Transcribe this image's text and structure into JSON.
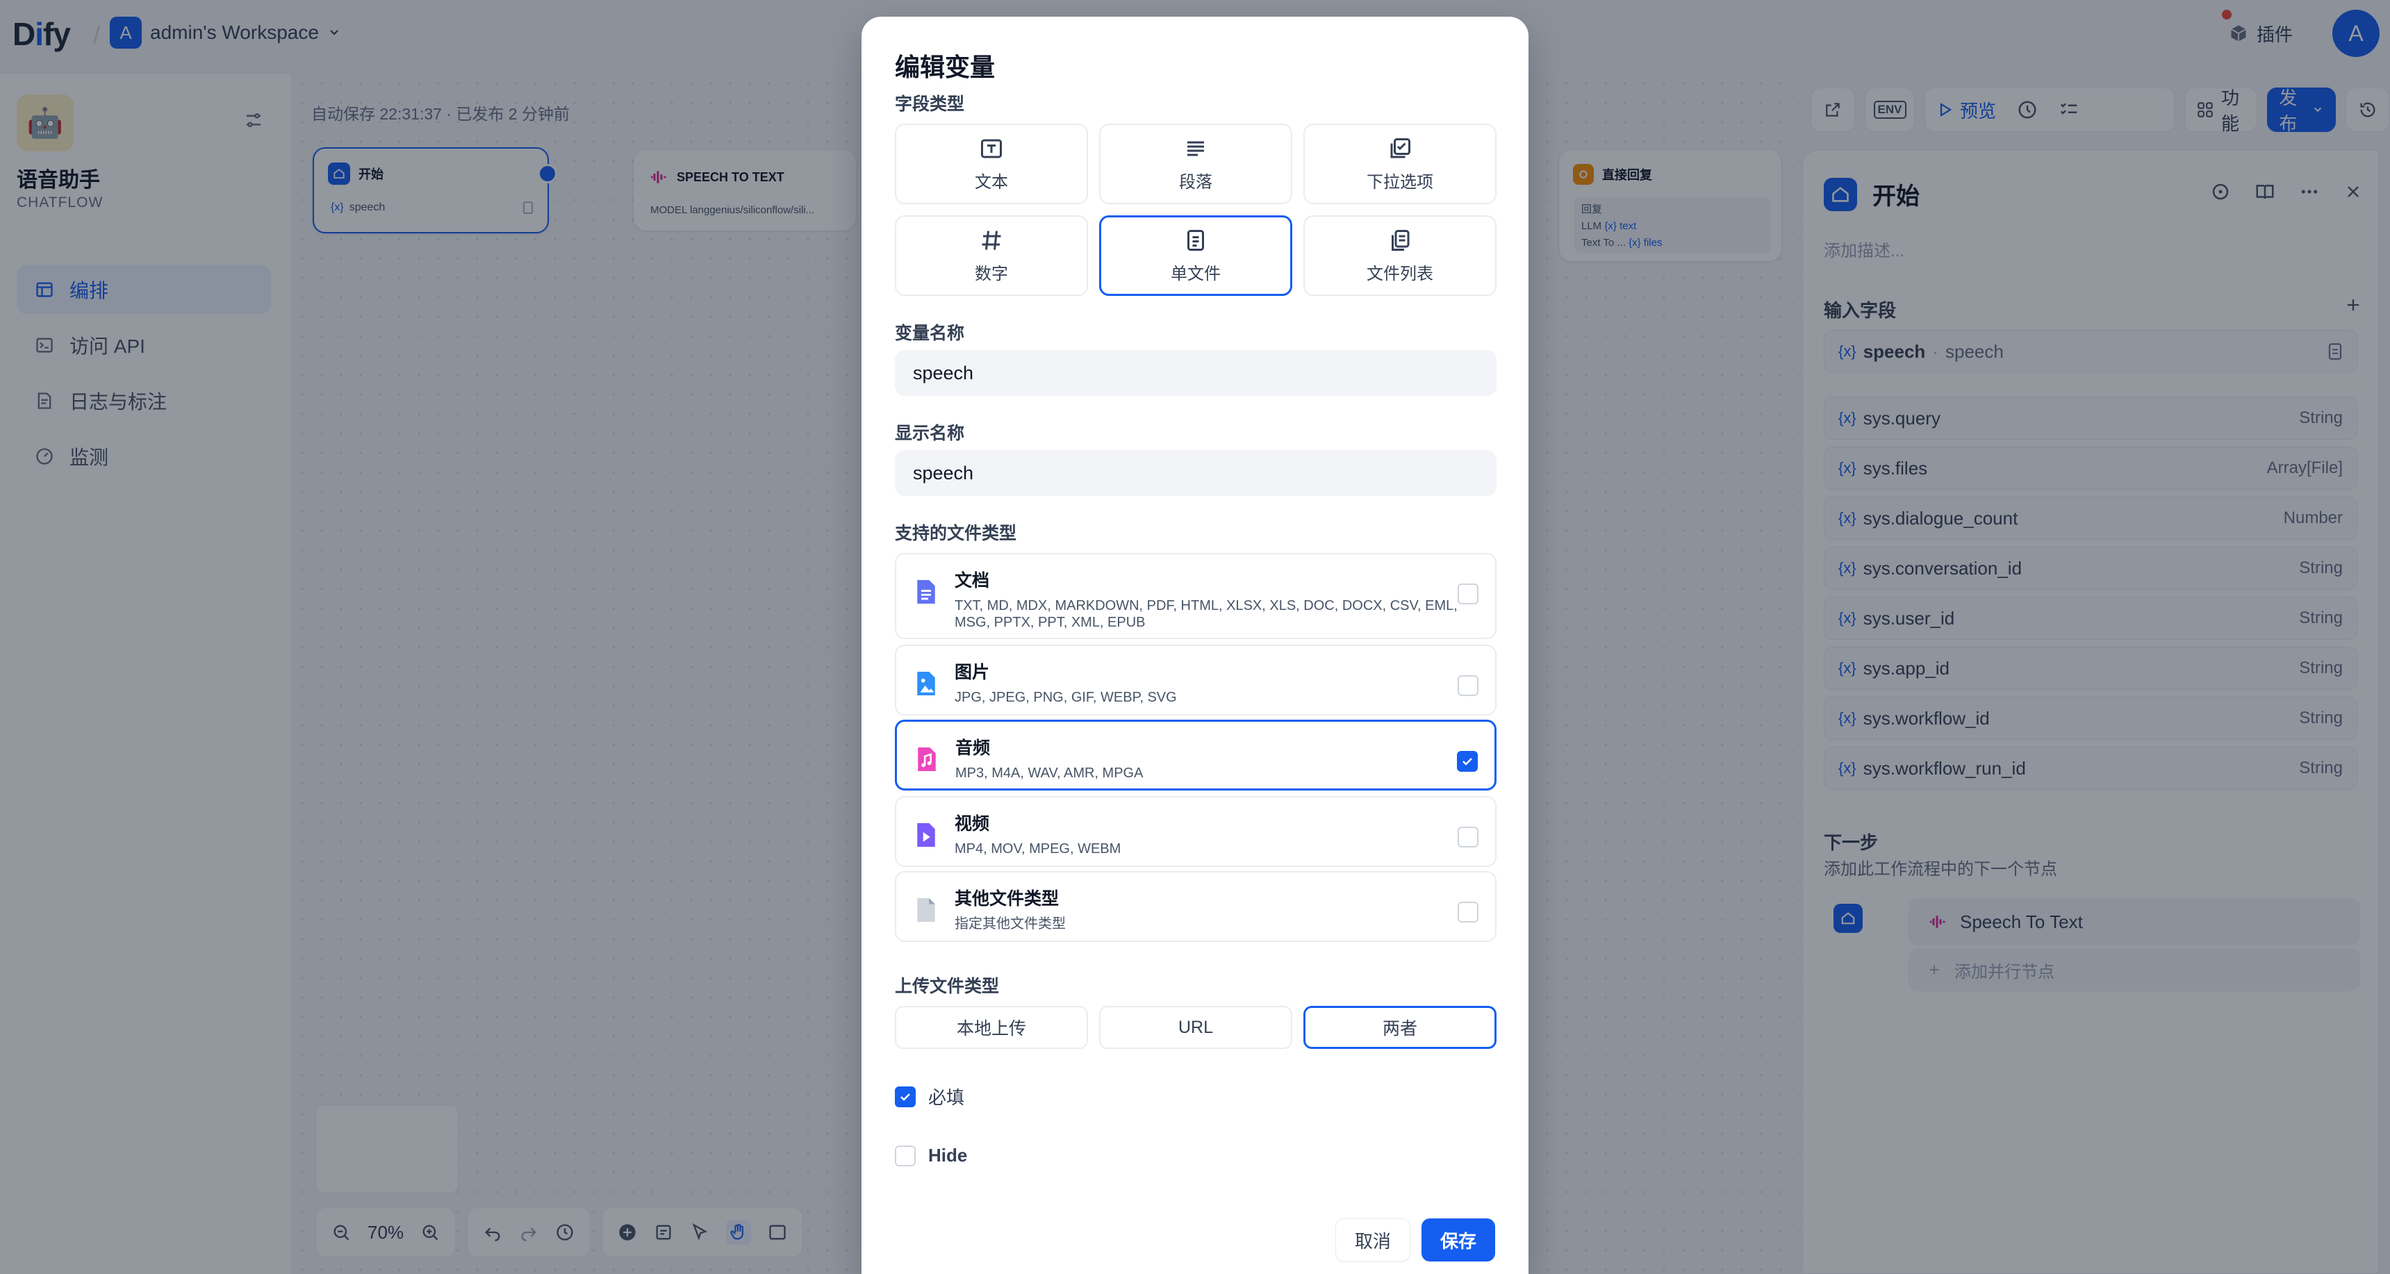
{
  "topbar": {
    "logo_d": "D",
    "logo_i": "i",
    "logo_rest": "fy",
    "workspace_initial": "A",
    "workspace_name": "admin's Workspace",
    "plugin_label": "插件",
    "user_initial": "A"
  },
  "sidebar": {
    "app_name": "语音助手",
    "app_type": "CHATFLOW",
    "items": [
      {
        "label": "编排",
        "icon": "layout-icon",
        "active": true
      },
      {
        "label": "访问 API",
        "icon": "terminal-icon",
        "active": false
      },
      {
        "label": "日志与标注",
        "icon": "log-icon",
        "active": false
      },
      {
        "label": "监测",
        "icon": "monitor-icon",
        "active": false
      }
    ]
  },
  "canvas": {
    "autosave": "自动保存 22:31:37 · 已发布 2 分钟前",
    "start_node": {
      "title": "开始",
      "var": "speech"
    },
    "stt_node": {
      "title": "SPEECH TO TEXT",
      "model": "MODEL langgenius/siliconflow/sili..."
    },
    "answer_node": {
      "title": "直接回复",
      "label": "回复",
      "line1_a": "LLM",
      "line1_b": "text",
      "line2_a": "Text To ...",
      "line2_b": "files"
    },
    "tools": {
      "preview": "预览",
      "features": "功能",
      "publish": "发布",
      "env": "ENV"
    },
    "zoom": "70%"
  },
  "panel": {
    "title": "开始",
    "desc_placeholder": "添加描述...",
    "fields_label": "输入字段",
    "input_var": {
      "name": "speech",
      "label": "speech"
    },
    "sys_vars": [
      {
        "name": "sys.query",
        "type": "String"
      },
      {
        "name": "sys.files",
        "type": "Array[File]"
      },
      {
        "name": "sys.dialogue_count",
        "type": "Number"
      },
      {
        "name": "sys.conversation_id",
        "type": "String"
      },
      {
        "name": "sys.user_id",
        "type": "String"
      },
      {
        "name": "sys.app_id",
        "type": "String"
      },
      {
        "name": "sys.workflow_id",
        "type": "String"
      },
      {
        "name": "sys.workflow_run_id",
        "type": "String"
      }
    ],
    "var_prefix": "{x}",
    "next_label": "下一步",
    "next_desc": "添加此工作流程中的下一个节点",
    "next_node": "Speech To Text",
    "add_parallel": "添加并行节点"
  },
  "modal": {
    "title": "编辑变量",
    "field_type_label": "字段类型",
    "field_types": [
      {
        "label": "文本",
        "icon": "text-input-icon",
        "selected": false
      },
      {
        "label": "段落",
        "icon": "paragraph-icon",
        "selected": false
      },
      {
        "label": "下拉选项",
        "icon": "select-icon",
        "selected": false
      },
      {
        "label": "数字",
        "icon": "number-icon",
        "selected": false
      },
      {
        "label": "单文件",
        "icon": "file-icon",
        "selected": true
      },
      {
        "label": "文件列表",
        "icon": "file-list-icon",
        "selected": false
      }
    ],
    "var_name_label": "变量名称",
    "var_name_value": "speech",
    "display_name_label": "显示名称",
    "display_name_value": "speech",
    "file_types_label": "支持的文件类型",
    "file_types": [
      {
        "name": "文档",
        "ext": "TXT, MD, MDX, MARKDOWN, PDF, HTML, XLSX, XLS, DOC, DOCX, CSV, EML, MSG, PPTX, PPT, XML, EPUB",
        "checked": false,
        "color": "#6172F3",
        "icon": "document-icon"
      },
      {
        "name": "图片",
        "ext": "JPG, JPEG, PNG, GIF, WEBP, SVG",
        "checked": false,
        "color": "#2E90FA",
        "icon": "image-icon"
      },
      {
        "name": "音频",
        "ext": "MP3, M4A, WAV, AMR, MPGA",
        "checked": true,
        "color": "#EE46BC",
        "icon": "audio-icon"
      },
      {
        "name": "视频",
        "ext": "MP4, MOV, MPEG, WEBM",
        "checked": false,
        "color": "#7A5AF8",
        "icon": "video-icon"
      },
      {
        "name": "其他文件类型",
        "ext": "指定其他文件类型",
        "checked": false,
        "color": "#D0D5DD",
        "icon": "other-file-icon"
      }
    ],
    "upload_label": "上传文件类型",
    "upload_methods": [
      {
        "label": "本地上传",
        "selected": false
      },
      {
        "label": "URL",
        "selected": false
      },
      {
        "label": "两者",
        "selected": true
      }
    ],
    "required_label": "必填",
    "required_checked": true,
    "hide_label": "Hide",
    "hide_checked": false,
    "cancel": "取消",
    "save": "保存"
  },
  "colors": {
    "accent": "#155EEF"
  }
}
